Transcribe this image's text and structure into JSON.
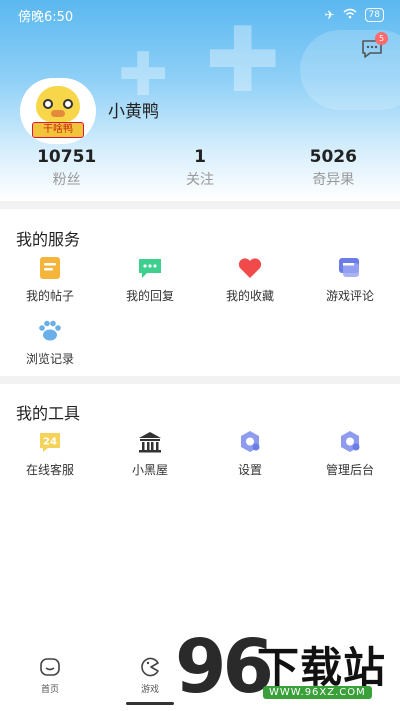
{
  "status_bar": {
    "time": "傍晚6:50",
    "battery": "78"
  },
  "header": {
    "message_badge": "5"
  },
  "profile": {
    "avatar_label": "干啥鸭",
    "username": "小黄鸭",
    "stats": [
      {
        "value": "10751",
        "label": "粉丝"
      },
      {
        "value": "1",
        "label": "关注"
      },
      {
        "value": "5026",
        "label": "奇异果"
      }
    ]
  },
  "services": {
    "title": "我的服务",
    "items": [
      {
        "label": "我的帖子",
        "icon": "post-icon",
        "color": "#f5b53a"
      },
      {
        "label": "我的回复",
        "icon": "reply-icon",
        "color": "#3ccf8e"
      },
      {
        "label": "我的收藏",
        "icon": "heart-icon",
        "color": "#f04a4a"
      },
      {
        "label": "游戏评论",
        "icon": "comment-icon",
        "color": "#6b7be8"
      },
      {
        "label": "浏览记录",
        "icon": "paw-icon",
        "color": "#6aaeea"
      }
    ]
  },
  "tools": {
    "title": "我的工具",
    "items": [
      {
        "label": "在线客服",
        "icon": "service-24-icon",
        "badge": "24",
        "color": "#f5c53a"
      },
      {
        "label": "小黑屋",
        "icon": "house-icon",
        "color": "#333333"
      },
      {
        "label": "设置",
        "icon": "settings-icon",
        "color": "#6b7be8"
      },
      {
        "label": "管理后台",
        "icon": "admin-icon",
        "color": "#6b7be8"
      }
    ]
  },
  "bottom_nav": [
    {
      "label": "首页",
      "icon": "home-icon"
    },
    {
      "label": "游戏",
      "icon": "game-icon"
    }
  ],
  "watermark": {
    "number": "96",
    "text": "下载站",
    "url": "WWW.96XZ.COM"
  }
}
